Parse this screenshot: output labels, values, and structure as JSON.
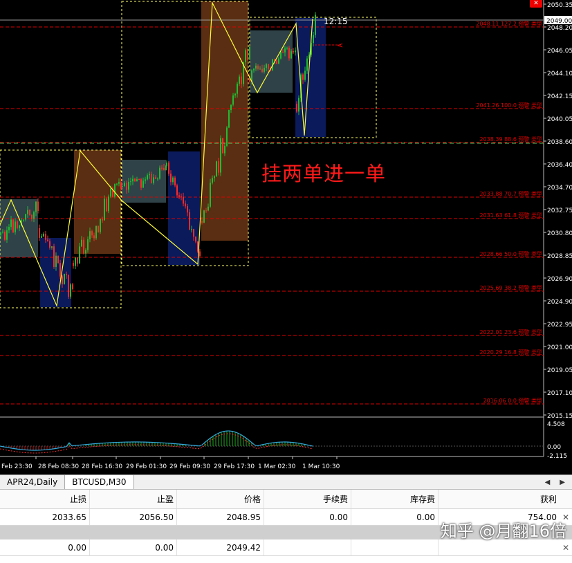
{
  "annotation": "挂两单进一单",
  "countdown": "12:15",
  "current_price_label": "2049.00",
  "price_axis": [
    "2050.35",
    "2048.20",
    "2046.05",
    "2044.10",
    "2042.15",
    "2040.05",
    "2038.60",
    "2036.40",
    "2034.70",
    "2032.75",
    "2030.80",
    "2028.85",
    "2026.90",
    "2024.90",
    "2022.95",
    "2021.00",
    "2019.05",
    "2017.10",
    "2015.15"
  ],
  "osc_axis": [
    "4.508",
    "0.00",
    "-2.115"
  ],
  "time_axis": [
    "Feb 23:30",
    "28 Feb 08:30",
    "28 Feb 16:30",
    "29 Feb 01:30",
    "29 Feb 09:30",
    "29 Feb 17:30",
    "1 Mar 02:30",
    "1 Mar 10:30"
  ],
  "fib_levels": [
    {
      "label": "2048.11 127.2 预警 类型"
    },
    {
      "label": "2041.26 100.0 预警 类型"
    },
    {
      "label": "2038.39 88.6 预警 类型"
    },
    {
      "label": "2033.88 70.7 预警 类型"
    },
    {
      "label": "2031.63 61.8 预警 类型"
    },
    {
      "label": "2028.66 50.0 预警 类型"
    },
    {
      "label": "2025.69 38.2 预警 类型"
    },
    {
      "label": "2022.01 23.6 预警 类型"
    },
    {
      "label": "2020.29 16.8 预警 类型"
    },
    {
      "label": "2016.06 0.0 预警 类型"
    }
  ],
  "tabs": [
    "APR24,Daily",
    "BTCUSD,M30"
  ],
  "table": {
    "headers": [
      "止损",
      "止盈",
      "价格",
      "手续费",
      "库存费",
      "获利"
    ],
    "rows": [
      [
        "2033.65",
        "2056.50",
        "2048.95",
        "0.00",
        "0.00",
        "754.00"
      ],
      [
        "",
        "",
        "",
        "",
        "",
        ""
      ],
      [
        "0.00",
        "0.00",
        "2049.42",
        "",
        "",
        ""
      ]
    ]
  },
  "watermark": "知乎 @月翻16倍",
  "colors": {
    "fib": "#e00000",
    "bull": "#22bb33",
    "bear": "#ff2a2a",
    "zigzag": "#ffff33",
    "box_dark": "#2f4248",
    "box_navy": "#0a1a5a",
    "box_brown": "#5a2e12"
  }
}
